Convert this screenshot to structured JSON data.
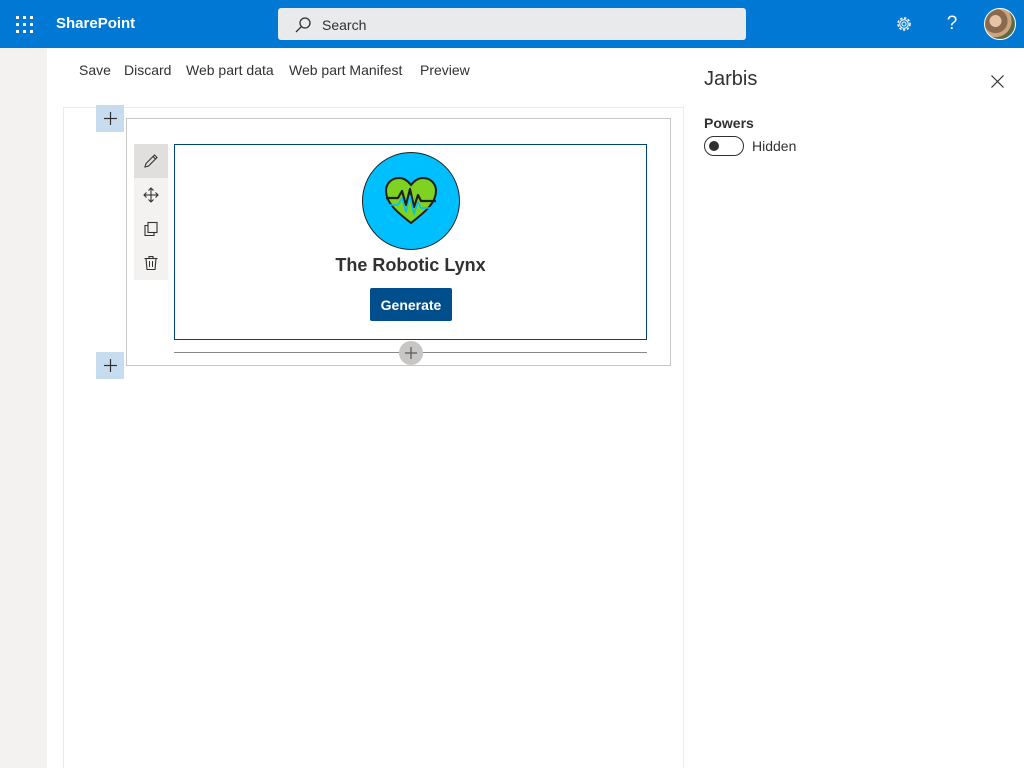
{
  "suite_bar": {
    "app_name": "SharePoint",
    "search_placeholder": "Search",
    "help_label": "?",
    "accent_color": "#0078d4"
  },
  "command_bar": {
    "items": [
      {
        "label": "Save"
      },
      {
        "label": "Discard"
      },
      {
        "label": "Web part data"
      },
      {
        "label": "Web part Manifest"
      },
      {
        "label": "Preview"
      }
    ]
  },
  "canvas": {
    "toolbar_icons": [
      "edit-icon",
      "move-icon",
      "duplicate-icon",
      "delete-icon"
    ],
    "webpart": {
      "title": "The Robotic Lynx",
      "button_label": "Generate",
      "logo_icon": "heart-pulse-icon",
      "logo_bg_color": "#00bfff",
      "button_color": "#004e8c"
    }
  },
  "property_pane": {
    "title": "Jarbis",
    "field_label": "Powers",
    "toggle_state_text": "Hidden",
    "toggle_on": false
  }
}
